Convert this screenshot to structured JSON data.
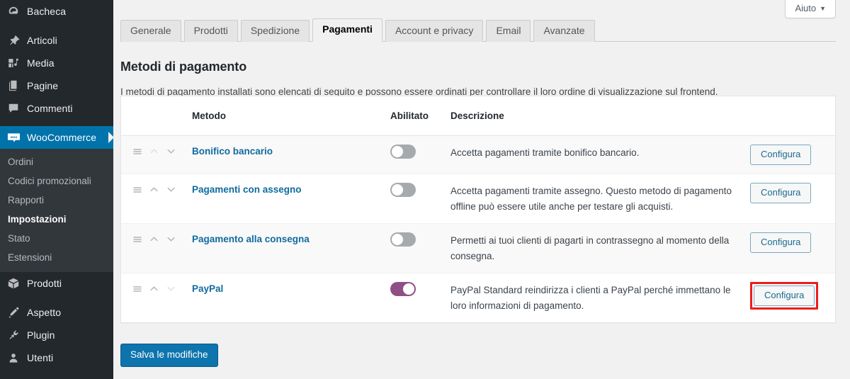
{
  "sidebar": {
    "items": [
      {
        "label": "Bacheca",
        "icon": "dashboard-icon",
        "current": false,
        "gap_after": true
      },
      {
        "label": "Articoli",
        "icon": "pin-icon",
        "current": false,
        "gap_after": false
      },
      {
        "label": "Media",
        "icon": "media-icon",
        "current": false,
        "gap_after": false
      },
      {
        "label": "Pagine",
        "icon": "pages-icon",
        "current": false,
        "gap_after": false
      },
      {
        "label": "Commenti",
        "icon": "comment-icon",
        "current": false,
        "gap_after": true
      },
      {
        "label": "WooCommerce",
        "icon": "woocommerce-icon",
        "current": true,
        "gap_after": false
      }
    ],
    "submenu": [
      {
        "label": "Ordini",
        "active": false
      },
      {
        "label": "Codici promozionali",
        "active": false
      },
      {
        "label": "Rapporti",
        "active": false
      },
      {
        "label": "Impostazioni",
        "active": true
      },
      {
        "label": "Stato",
        "active": false
      },
      {
        "label": "Estensioni",
        "active": false
      }
    ],
    "items_bottom": [
      {
        "label": "Prodotti",
        "icon": "product-box-icon",
        "gap_after": true
      },
      {
        "label": "Aspetto",
        "icon": "brush-icon",
        "gap_after": false
      },
      {
        "label": "Plugin",
        "icon": "plug-icon",
        "gap_after": false
      },
      {
        "label": "Utenti",
        "icon": "user-icon",
        "gap_after": false
      }
    ]
  },
  "help": {
    "label": "Aiuto",
    "caret": "▼"
  },
  "tabs": [
    {
      "label": "Generale",
      "active": false
    },
    {
      "label": "Prodotti",
      "active": false
    },
    {
      "label": "Spedizione",
      "active": false
    },
    {
      "label": "Pagamenti",
      "active": true
    },
    {
      "label": "Account e privacy",
      "active": false
    },
    {
      "label": "Email",
      "active": false
    },
    {
      "label": "Avanzate",
      "active": false
    }
  ],
  "page": {
    "title": "Metodi di pagamento",
    "description": "I metodi di pagamento installati sono elencati di seguito e possono essere ordinati per controllare il loro ordine di visualizzazione sul frontend."
  },
  "table": {
    "headers": {
      "sort": "",
      "method": "Metodo",
      "enabled": "Abilitato",
      "description": "Descrizione",
      "action": ""
    },
    "rows": [
      {
        "method": "Bonifico bancario",
        "enabled": false,
        "description": "Accetta pagamenti tramite bonifico bancario.",
        "action_label": "Configura",
        "highlighted": false,
        "up_disabled": true,
        "down_disabled": false
      },
      {
        "method": "Pagamenti con assegno",
        "enabled": false,
        "description": "Accetta pagamenti tramite assegno. Questo metodo di pagamento offline può essere utile anche per testare gli acquisti.",
        "action_label": "Configura",
        "highlighted": false,
        "up_disabled": false,
        "down_disabled": false
      },
      {
        "method": "Pagamento alla consegna",
        "enabled": false,
        "description": "Permetti ai tuoi clienti di pagarti in contrassegno al momento della consegna.",
        "action_label": "Configura",
        "highlighted": false,
        "up_disabled": false,
        "down_disabled": false
      },
      {
        "method": "PayPal",
        "enabled": true,
        "description": "PayPal Standard reindirizza i clienti a PayPal perché immettano le loro informazioni di pagamento.",
        "action_label": "Configura",
        "highlighted": true,
        "up_disabled": false,
        "down_disabled": true
      }
    ]
  },
  "save": {
    "label": "Salva le modifiche"
  },
  "colors": {
    "sidebar_bg": "#23282d",
    "submenu_bg": "#32373c",
    "current_item": "#0073aa",
    "link_blue": "#0f6b9e",
    "toggle_on": "#8f4f86",
    "toggle_off": "#a7aaad",
    "highlight_red": "#ee1c1c",
    "save_button": "#0d74ae",
    "page_bg": "#f1f1f1"
  }
}
